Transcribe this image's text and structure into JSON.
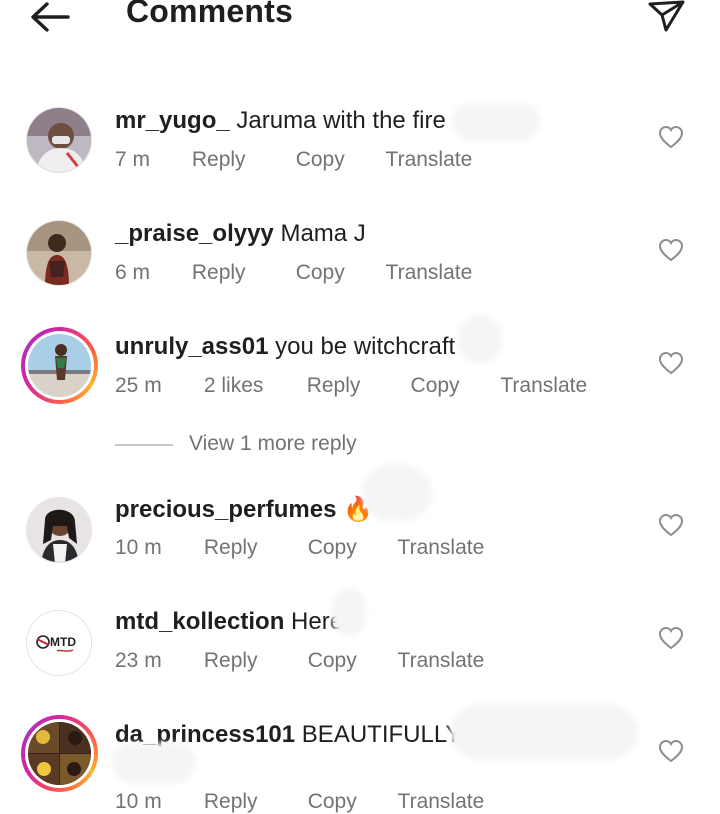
{
  "header": {
    "title": "Comments",
    "back_icon": "arrow-left-icon",
    "send_icon": "paper-plane-icon"
  },
  "comments": [
    {
      "username": "mr_yugo_",
      "text": "Jaruma with the fire",
      "time": "7 m",
      "likes": "",
      "reply": "Reply",
      "copy": "Copy",
      "translate": "Translate",
      "story_ring": false
    },
    {
      "username": "_praise_olyyy",
      "text": "Mama J",
      "time": "6 m",
      "likes": "",
      "reply": "Reply",
      "copy": "Copy",
      "translate": "Translate",
      "story_ring": false
    },
    {
      "username": "unruly_ass01",
      "text": "you be witchcraft",
      "time": "25 m",
      "likes": "2 likes",
      "reply": "Reply",
      "copy": "Copy",
      "translate": "Translate",
      "story_ring": true
    },
    {
      "username": "precious_perfumes",
      "text": "🔥",
      "time": "10 m",
      "likes": "",
      "reply": "Reply",
      "copy": "Copy",
      "translate": "Translate",
      "story_ring": false
    },
    {
      "username": "mtd_kollection",
      "text": "Here",
      "time": "23 m",
      "likes": "",
      "reply": "Reply",
      "copy": "Copy",
      "translate": "Translate",
      "story_ring": false,
      "avatar_logo_text": "MTD"
    },
    {
      "username": "da_princess101",
      "text": "BEAUTIFULLY",
      "time": "10 m",
      "likes": "",
      "reply": "Reply",
      "copy": "Copy",
      "translate": "Translate",
      "story_ring": true
    }
  ],
  "view_more_replies": "View 1 more reply",
  "colors": {
    "text": "#1f1f1f",
    "secondary": "#737373",
    "story_ring": [
      "#d6249f",
      "#fd5949",
      "#fdb22d"
    ]
  }
}
